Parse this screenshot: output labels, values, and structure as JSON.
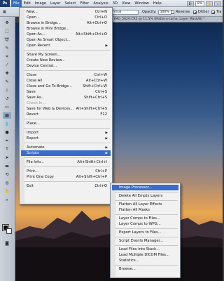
{
  "menubar": {
    "logo": "Ps",
    "items": [
      "File",
      "Edit",
      "Image",
      "Layer",
      "Select",
      "Filter",
      "Analysis",
      "3D",
      "View",
      "Window",
      "Help"
    ],
    "active": "File",
    "zoom": "8%"
  },
  "options": {
    "mode": "rmal",
    "opacity_label": "Opacity:",
    "opacity_value": "100%",
    "reverse_label": "Reverse",
    "dither_label": "Dither",
    "transparency_label": "Tra"
  },
  "document_tab": "IMG_5629.CR2 @ 11.5% (Matte-o-rama, Layer Mask/8) *",
  "file_menu": {
    "items": [
      {
        "label": "New...",
        "shortcut": "Ctrl+N"
      },
      {
        "label": "Open...",
        "shortcut": "Ctrl+O"
      },
      {
        "label": "Browse in Bridge...",
        "shortcut": "Alt+Ctrl+O"
      },
      {
        "label": "Browse in Mini Bridge...",
        "shortcut": ""
      },
      {
        "label": "Open As...",
        "shortcut": "Alt+Shift+Ctrl+O"
      },
      {
        "label": "Open As Smart Object...",
        "shortcut": ""
      },
      {
        "label": "Open Recent",
        "shortcut": ""
      },
      {
        "label": "Share My Screen...",
        "shortcut": ""
      },
      {
        "label": "Create New Review...",
        "shortcut": ""
      },
      {
        "label": "Device Central...",
        "shortcut": ""
      },
      {
        "label": "Close",
        "shortcut": "Ctrl+W"
      },
      {
        "label": "Close All",
        "shortcut": "Alt+Ctrl+W"
      },
      {
        "label": "Close and Go To Bridge...",
        "shortcut": "Shift+Ctrl+W"
      },
      {
        "label": "Save",
        "shortcut": "Ctrl+S"
      },
      {
        "label": "Save As...",
        "shortcut": "Shift+Ctrl+S"
      },
      {
        "label": "Check In...",
        "shortcut": ""
      },
      {
        "label": "Save for Web & Devices...",
        "shortcut": "Alt+Shift+Ctrl+S"
      },
      {
        "label": "Revert",
        "shortcut": "F12"
      },
      {
        "label": "Place...",
        "shortcut": ""
      },
      {
        "label": "Import",
        "shortcut": ""
      },
      {
        "label": "Export",
        "shortcut": ""
      },
      {
        "label": "Automate",
        "shortcut": ""
      },
      {
        "label": "Scripts",
        "shortcut": ""
      },
      {
        "label": "File Info...",
        "shortcut": "Alt+Shift+Ctrl+I"
      },
      {
        "label": "Print...",
        "shortcut": "Ctrl+P"
      },
      {
        "label": "Print One Copy",
        "shortcut": "Alt+Shift+Ctrl+P"
      },
      {
        "label": "Exit",
        "shortcut": "Ctrl+Q"
      }
    ]
  },
  "scripts_menu": {
    "items": [
      "Image Processor...",
      "Delete All Empty Layers",
      "Flatten All Layer Effects",
      "Flatten All Masks",
      "Layer Comps to Files...",
      "Layer Comps to WPG...",
      "Export Layers to Files...",
      "Script Events Manager...",
      "Load Files into Stack...",
      "Load Multiple DICOM Files...",
      "Statistics...",
      "Browse..."
    ]
  }
}
